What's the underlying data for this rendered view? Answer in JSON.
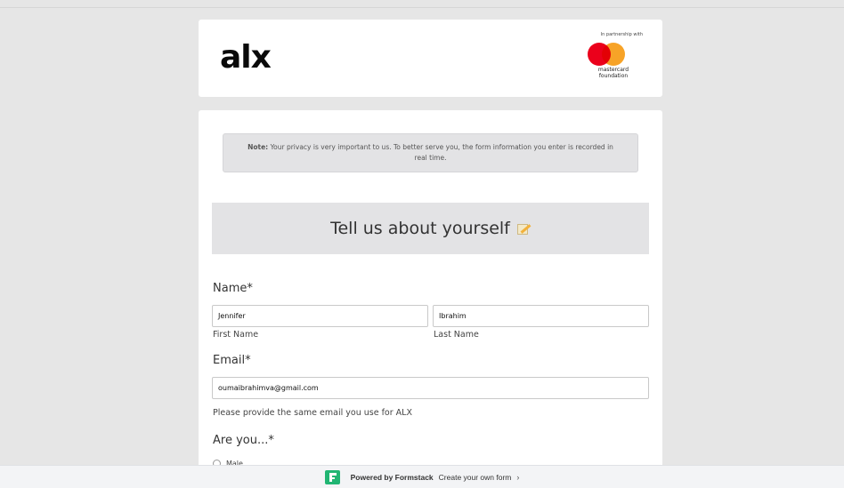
{
  "header": {
    "logo_text": "alx",
    "partner_label": "In partnership with",
    "partner_name_line1": "mastercard",
    "partner_name_line2": "foundation"
  },
  "note": {
    "bold": "Note:",
    "text": " Your privacy is very important to us. To better serve you, the form information you enter is recorded in real time."
  },
  "section": {
    "title": "Tell us about yourself",
    "icon": "memo-icon"
  },
  "name_field": {
    "label": "Name*",
    "first_value": "Jennifer",
    "first_sublabel": "First Name",
    "last_value": "Ibrahim",
    "last_sublabel": "Last Name"
  },
  "email_field": {
    "label": "Email*",
    "value": "oumaibrahimva@gmail.com",
    "help": "Please provide the same email you use for ALX"
  },
  "gender_field": {
    "label": "Are you...*",
    "options": [
      "Male"
    ]
  },
  "footer": {
    "powered": "Powered by Formstack",
    "create": "Create your own form",
    "chevron": "›"
  },
  "colors": {
    "background": "#e6e6e6",
    "panel_gray": "#e3e3e5",
    "formstack_green": "#21b573",
    "mastercard_red": "#eb001b",
    "mastercard_orange": "#f79e1b"
  }
}
